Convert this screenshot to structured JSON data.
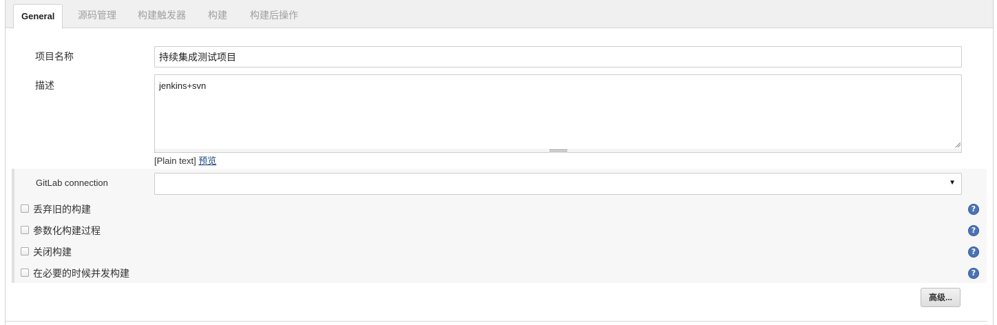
{
  "tabs": [
    {
      "label": "General",
      "active": true
    },
    {
      "label": "源码管理",
      "active": false
    },
    {
      "label": "构建触发器",
      "active": false
    },
    {
      "label": "构建",
      "active": false
    },
    {
      "label": "构建后操作",
      "active": false
    }
  ],
  "general": {
    "project_name_label": "项目名称",
    "project_name_value": "持续集成测试项目",
    "description_label": "描述",
    "description_value": "jenkins+svn",
    "plain_text_label": "[Plain text]",
    "preview_link": "预览"
  },
  "gitlab": {
    "connection_label": "GitLab connection",
    "connection_selected": ""
  },
  "options": [
    {
      "label": "丢弃旧的构建",
      "checked": false
    },
    {
      "label": "参数化构建过程",
      "checked": false
    },
    {
      "label": "关闭构建",
      "checked": false
    },
    {
      "label": "在必要的时候并发构建",
      "checked": false
    }
  ],
  "help_icon_glyph": "?",
  "advanced_button": "高级...",
  "colors": {
    "help_icon": "#4a74b5",
    "link": "#204a87",
    "tab_bar": "#f0f0f0"
  }
}
